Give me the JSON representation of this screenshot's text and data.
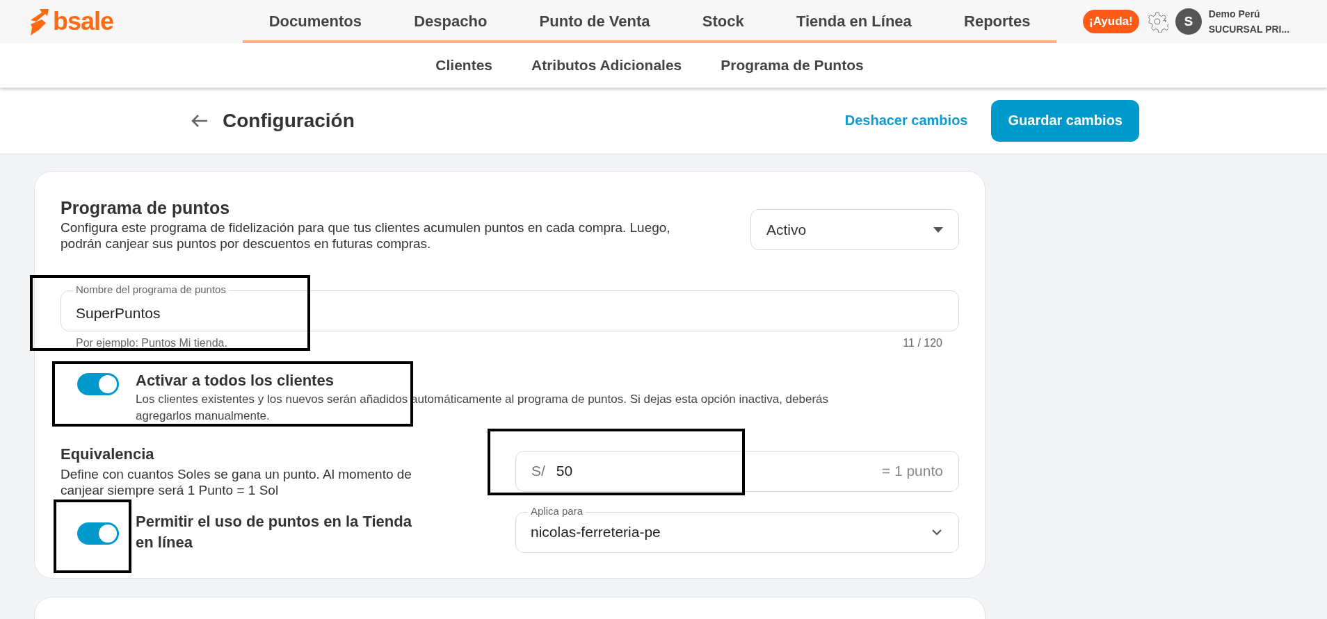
{
  "brand": {
    "name": "bsale"
  },
  "main_nav": [
    {
      "label": "Documentos",
      "selected": false
    },
    {
      "label": "Despacho",
      "selected": false
    },
    {
      "label": "Punto de Venta",
      "selected": false
    },
    {
      "label": "Stock",
      "selected": false
    },
    {
      "label": "Tienda en Línea",
      "selected": false
    },
    {
      "label": "Reportes",
      "selected": false
    }
  ],
  "help_button": "¡Ayuda!",
  "user": {
    "initial": "S",
    "name": "Demo Perú",
    "branch": "SUCURSAL PRI..."
  },
  "sub_nav": [
    {
      "label": "Clientes",
      "selected": false
    },
    {
      "label": "Atributos Adicionales",
      "selected": false
    },
    {
      "label": "Programa de Puntos",
      "selected": false
    }
  ],
  "header": {
    "title": "Configuración",
    "undo": "Deshacer cambios",
    "save": "Guardar cambios"
  },
  "card": {
    "title": "Programa de puntos",
    "description": "Configura este programa de fidelización para que tus clientes acumulen puntos en cada compra. Luego, podrán canjear sus puntos por descuentos en futuras compras.",
    "status_select": {
      "value": "Activo"
    },
    "name_field": {
      "label": "Nombre del programa de puntos",
      "value": "SuperPuntos",
      "helper": "Por ejemplo: Puntos Mi tienda.",
      "counter": "11 / 120"
    },
    "all_clients": {
      "on": true,
      "title": "Activar a todos los clientes",
      "description": "Los clientes existentes y los nuevos serán añadidos automáticamente al programa de puntos. Si dejas esta opción inactiva, deberás agregarlos manualmente."
    },
    "equivalence": {
      "title": "Equivalencia",
      "description": "Define con cuantos Soles se gana un punto. Al momento de canjear siempre será 1 Punto = 1 Sol",
      "prefix": "S/",
      "value": "50",
      "suffix": "= 1 punto"
    },
    "online_store": {
      "on": true,
      "title": "Permitir el uso de puntos en la Tienda en línea",
      "select_label": "Aplica para",
      "select_value": "nicolas-ferreteria-pe"
    }
  }
}
